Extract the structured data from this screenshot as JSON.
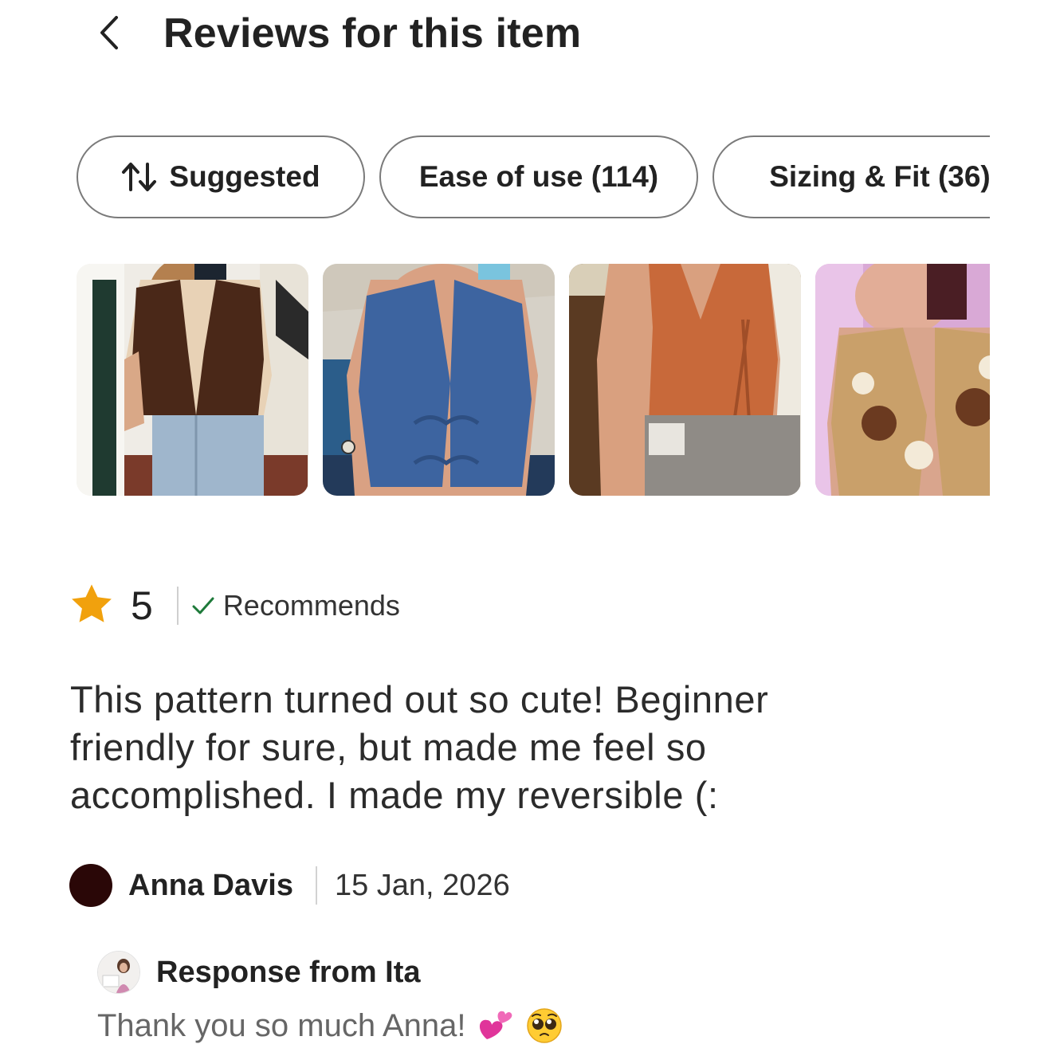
{
  "header": {
    "title": "Reviews for this item",
    "back_icon": "chevron-left-icon"
  },
  "filters": {
    "sort_label": "Suggested",
    "sort_icon": "sort-arrows-icon",
    "chips": [
      "Ease of use (114)",
      "Sizing & Fit (36)"
    ]
  },
  "photos": [
    {
      "description_icon": "review-photo-brown-vest"
    },
    {
      "description_icon": "review-photo-blue-vest"
    },
    {
      "description_icon": "review-photo-orange-vest"
    },
    {
      "description_icon": "review-photo-floral-vest"
    }
  ],
  "review": {
    "rating": "5",
    "rating_fraction": 1.0,
    "star_color": "#f1a10d",
    "recommends_label": "Recommends",
    "check_color": "#1e7a3a",
    "text": "This pattern turned out so cute! Beginner friendly for sure, but made me feel so accomplished. I made my reversible (:",
    "reviewer_name": "Anna Davis",
    "date": "15 Jan, 2026",
    "avatar_color": "#2a0707"
  },
  "response": {
    "title": "Response from Ita",
    "text": "Thank you so much Anna!",
    "emojis": [
      "two-hearts-emoji",
      "pleading-face-emoji"
    ]
  }
}
